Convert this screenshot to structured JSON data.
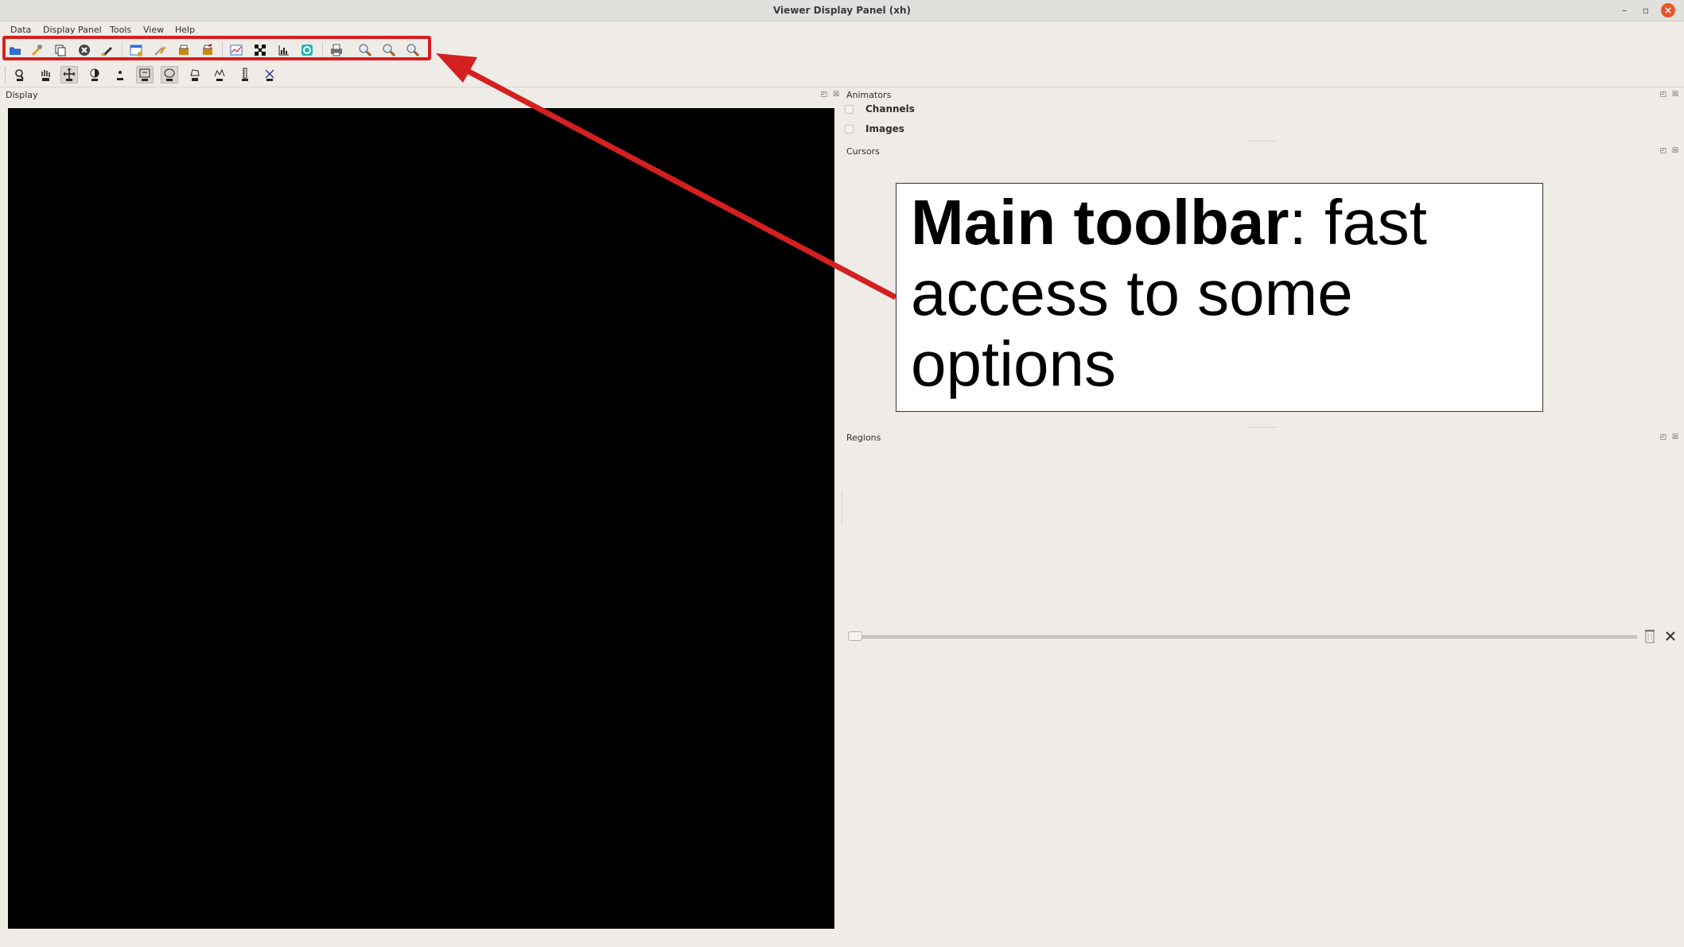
{
  "window": {
    "title": "Viewer Display Panel (xh)",
    "minimize_glyph": "–",
    "maximize_glyph": "▫",
    "close_glyph": "×"
  },
  "menu": {
    "items": [
      "Data",
      "Display Panel",
      "Tools",
      "View",
      "Help"
    ]
  },
  "toolbar_main": {
    "icons": [
      "open-data-icon",
      "adjust-wrench-icon",
      "copy-panel-icon",
      "unload-data-icon",
      "brush-icon",
      "new-panel-icon",
      "edit-panel-icon",
      "save-panel-icon",
      "export-panel-icon",
      "graph-icon",
      "fit-icon",
      "histogram-icon",
      "teal-region-icon",
      "print-icon",
      "zoom-in-icon",
      "zoom-out-icon",
      "zoom-reset-icon"
    ]
  },
  "toolbar_mouse": {
    "icons": [
      "zoom-tool-icon",
      "pan-tool-icon",
      "crosshair-tool-icon",
      "contrast-tool-icon",
      "point-tool-icon",
      "rectangle-region-icon",
      "ellipse-region-icon",
      "polygon-region-icon",
      "polyline-tool-icon",
      "ruler-tool-icon",
      "distance-tool-icon"
    ]
  },
  "panels": {
    "display": {
      "title": "Display"
    },
    "animators": {
      "title": "Animators",
      "rows": [
        {
          "label": "Channels",
          "checked": false
        },
        {
          "label": "Images",
          "checked": false
        }
      ]
    },
    "cursors": {
      "title": "Cursors"
    },
    "regions": {
      "title": "Regions"
    }
  },
  "dock_buttons": "◰ ☒",
  "annotation": {
    "bold": "Main toolbar",
    "text": ": fast access to some options",
    "color": "#d42020"
  },
  "colors": {
    "background": "#efebe7",
    "canvas": "#000000",
    "highlight": "#d42020"
  }
}
